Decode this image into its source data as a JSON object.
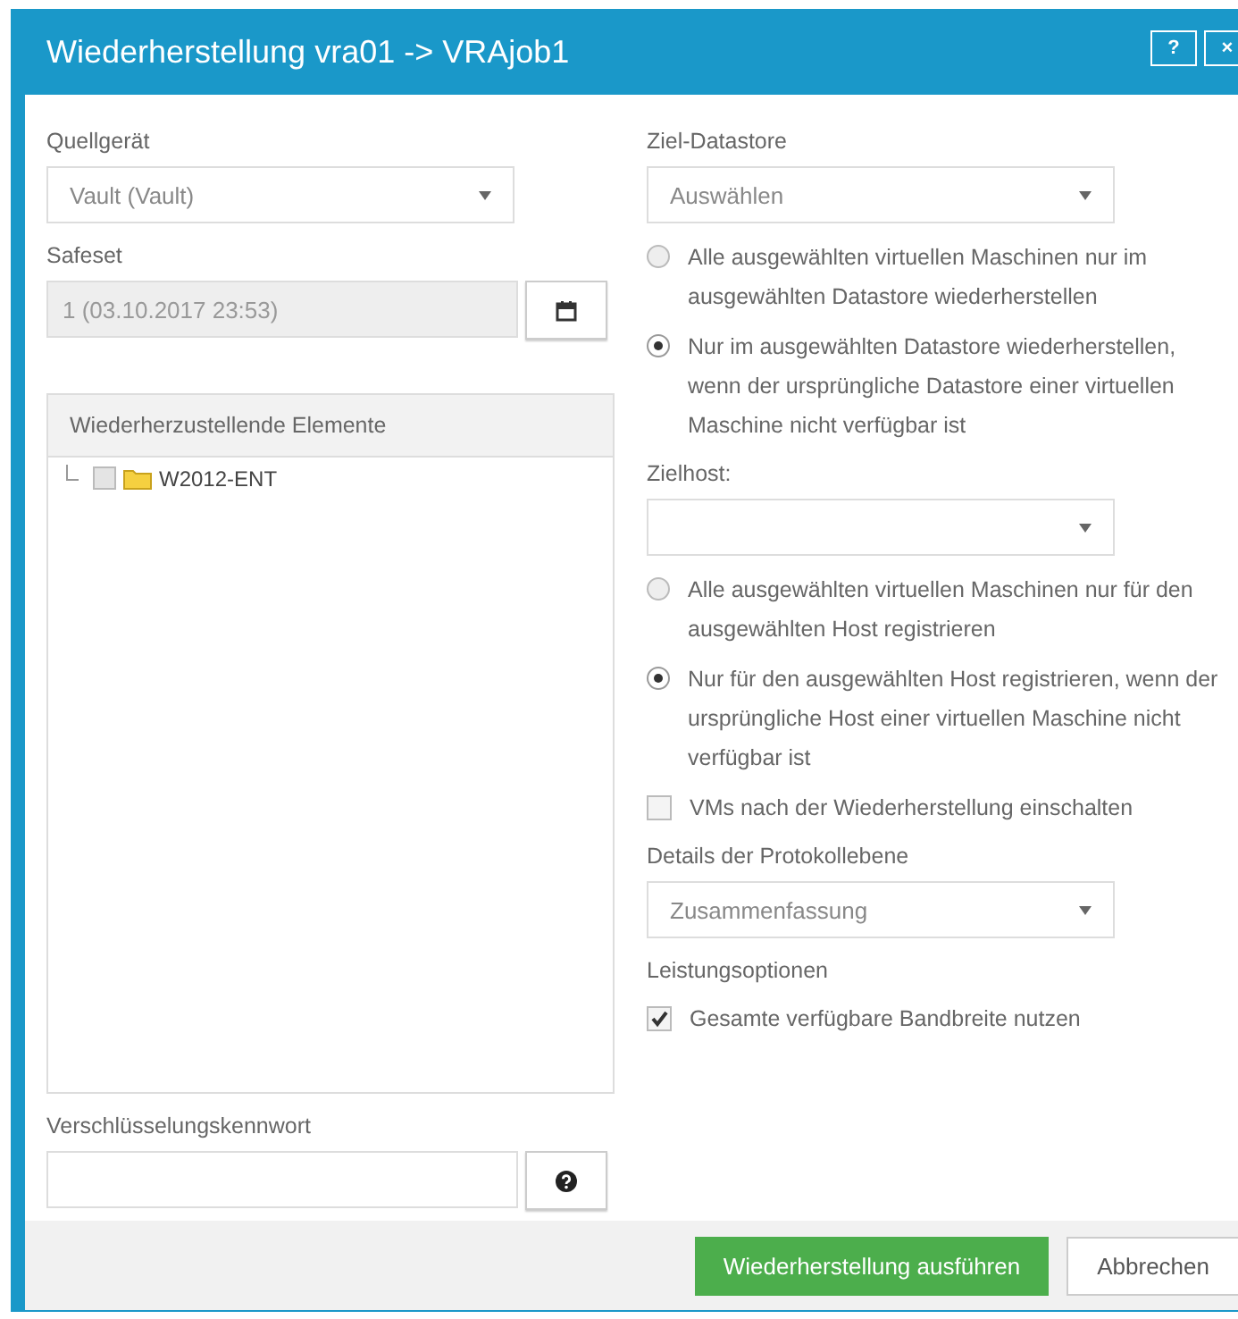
{
  "window": {
    "title": "Wiederherstellung vra01 -> VRAjob1",
    "help_button": "?",
    "close_button": "×"
  },
  "source": {
    "label": "Quellgerät",
    "value": "Vault (Vault)"
  },
  "safeset": {
    "label": "Safeset",
    "value": "1 (03.10.2017 23:53)",
    "disabled": true
  },
  "items_panel": {
    "title": "Wiederherzustellende Elemente",
    "items": [
      {
        "label": "W2012-ENT",
        "checked": false
      }
    ]
  },
  "encryption": {
    "label": "Verschlüsselungskennwort"
  },
  "target_datastore": {
    "label": "Ziel-Datastore",
    "value": "Auswählen"
  },
  "datastore_options": [
    {
      "label": "Alle ausgewählten virtuellen Maschinen nur im ausgewählten Datastore wiederherstellen",
      "selected": false
    },
    {
      "label": "Nur im ausgewählten Datastore wiederherstellen, wenn der ursprüngliche Datastore einer virtuellen Maschine nicht verfügbar ist",
      "selected": true
    }
  ],
  "target_host": {
    "label": "Zielhost:"
  },
  "host_options": [
    {
      "label": "Alle ausgewählten virtuellen Maschinen nur für den ausgewählten Host registrieren",
      "selected": false
    },
    {
      "label": "Nur für den ausgewählten Host registrieren, wenn der ursprüngliche Host einer virtuellen Maschine nicht verfügbar ist",
      "selected": true
    }
  ],
  "power_on": {
    "label": "VMs nach der Wiederherstellung einschalten",
    "checked": false
  },
  "log_level": {
    "label": "Details der Protokollebene",
    "value": "Zusammenfassung"
  },
  "performance": {
    "label": "Leistungsoptionen",
    "option": {
      "label": "Gesamte verfügbare Bandbreite nutzen",
      "checked": true
    }
  },
  "buttons": {
    "primary": "Wiederherstellung ausführen",
    "cancel": "Abbrechen"
  }
}
